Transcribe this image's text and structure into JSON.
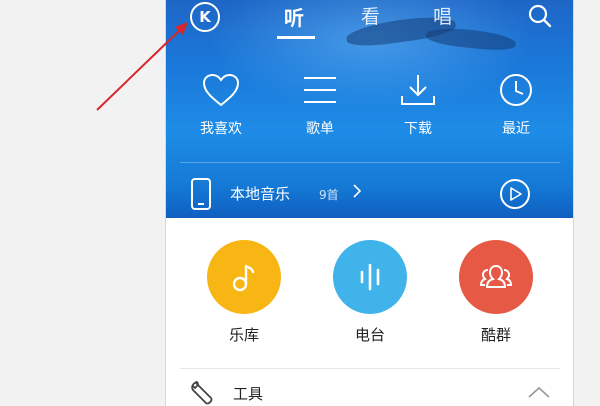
{
  "header": {
    "logo_text": "K",
    "tabs": [
      {
        "label": "听",
        "active": true
      },
      {
        "label": "看",
        "active": false
      },
      {
        "label": "唱",
        "active": false
      }
    ]
  },
  "quick_actions": [
    {
      "label": "我喜欢",
      "icon": "heart-icon"
    },
    {
      "label": "歌单",
      "icon": "list-icon"
    },
    {
      "label": "下载",
      "icon": "download-icon"
    },
    {
      "label": "最近",
      "icon": "clock-icon"
    }
  ],
  "local_music": {
    "label": "本地音乐",
    "count": "9首"
  },
  "features": [
    {
      "label": "乐库",
      "icon": "music-note-icon",
      "color": "#f7b614"
    },
    {
      "label": "电台",
      "icon": "radio-wave-icon",
      "color": "#3fb3ea"
    },
    {
      "label": "酷群",
      "icon": "group-icon",
      "color": "#e65a45"
    }
  ],
  "tools": {
    "label": "工具"
  },
  "colors": {
    "hero_blue": "#1a78d9",
    "annotation_arrow": "#d8262c"
  }
}
